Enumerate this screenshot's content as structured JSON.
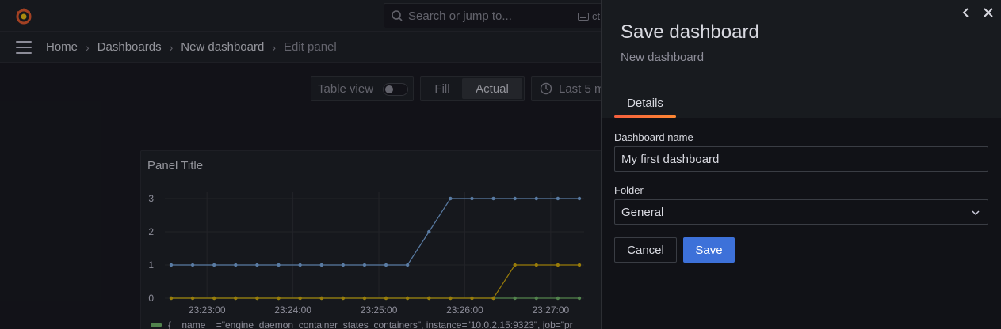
{
  "topbar": {
    "search_placeholder": "Search or jump to...",
    "shortcut_hint": "ct"
  },
  "breadcrumb": [
    "Home",
    "Dashboards",
    "New dashboard",
    "Edit panel"
  ],
  "toolbar": {
    "table_view_label": "Table view",
    "table_view_on": false,
    "fill_label": "Fill",
    "actual_label": "Actual",
    "time_range": "Last 5 m"
  },
  "panel": {
    "title": "Panel Title",
    "legend_text": "{__name__=\"engine_daemon_container_states_containers\", instance=\"10.0.2.15:9323\", job=\"pr"
  },
  "chart_data": {
    "type": "line",
    "x": [
      "23:22:35",
      "23:22:50",
      "23:23:05",
      "23:23:20",
      "23:23:35",
      "23:23:50",
      "23:24:05",
      "23:24:20",
      "23:24:35",
      "23:24:50",
      "23:25:05",
      "23:25:20",
      "23:25:35",
      "23:25:50",
      "23:26:05",
      "23:26:20",
      "23:26:35",
      "23:26:50",
      "23:27:05",
      "23:27:20"
    ],
    "x_ticks": [
      "23:23:00",
      "23:24:00",
      "23:25:00",
      "23:26:00",
      "23:27:00"
    ],
    "y_ticks": [
      0,
      1,
      2,
      3
    ],
    "ylim": [
      0,
      3
    ],
    "series": [
      {
        "color": "#7eb2ed",
        "values": [
          1,
          1,
          1,
          1,
          1,
          1,
          1,
          1,
          1,
          1,
          1,
          1,
          2,
          3,
          3,
          3,
          3,
          3,
          3,
          3
        ]
      },
      {
        "color": "#e0b400",
        "values": [
          0,
          0,
          0,
          0,
          0,
          0,
          0,
          0,
          0,
          0,
          0,
          0,
          0,
          0,
          0,
          0,
          1,
          1,
          1,
          1
        ]
      },
      {
        "color": "#73bf69",
        "values": [
          0,
          0,
          0,
          0,
          0,
          0,
          0,
          0,
          0,
          0,
          0,
          0,
          0,
          0,
          0,
          0,
          0,
          0,
          0,
          0
        ]
      }
    ]
  },
  "drawer": {
    "title": "Save dashboard",
    "subtitle": "New dashboard",
    "tab_details": "Details",
    "dashboard_name_label": "Dashboard name",
    "dashboard_name_value": "My first dashboard",
    "folder_label": "Folder",
    "folder_value": "General",
    "cancel_label": "Cancel",
    "save_label": "Save"
  },
  "colors": {
    "accent": "#3d71d9",
    "tab_underline": "#f55f3e",
    "background": "#111217",
    "surface": "#181b1f"
  }
}
